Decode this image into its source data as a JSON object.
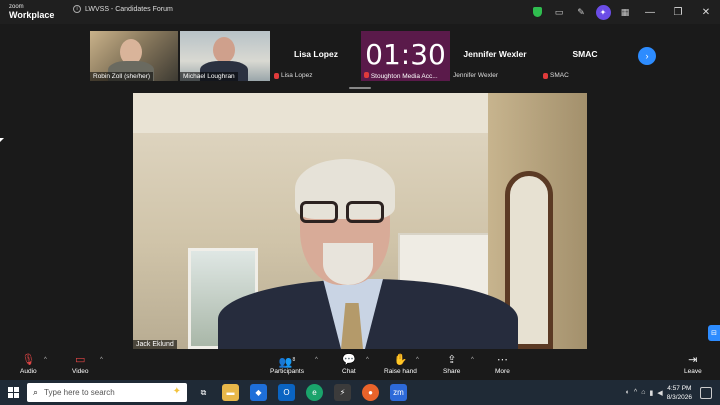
{
  "titlebar": {
    "brand_line1": "zoom",
    "brand_line2": "Workplace",
    "meeting_title": "LWVSS - Candidates  Forum",
    "icons": [
      "shield-icon",
      "tablet-icon",
      "pen-icon",
      "ai-companion-icon",
      "apps-icon"
    ],
    "window_buttons": [
      "minimize",
      "restore",
      "close"
    ]
  },
  "gallery": {
    "tiles": [
      {
        "name": "Robin Zoll (she/her)"
      },
      {
        "name": "Michael Loughran"
      },
      {
        "name": "Lisa Lopez",
        "label": "Lisa Lopez"
      },
      {
        "timer": "01:30",
        "label": "Stoughton Media Acc..."
      },
      {
        "name": "Jennifer Wexler",
        "label": "Jennifer Wexler"
      },
      {
        "name": "SMAC",
        "label": "SMAC"
      }
    ],
    "timer_color": "#5a1a4a"
  },
  "main_video": {
    "speaker_name": "Jack Eklund"
  },
  "toolbar": {
    "audio": "Audio",
    "video": "Video",
    "participants": "Participants",
    "participant_count": "8",
    "chat": "Chat",
    "raise_hand": "Raise hand",
    "share": "Share",
    "more": "More",
    "leave": "Leave"
  },
  "taskbar": {
    "search_placeholder": "Type here to search",
    "time": "4:57 PM",
    "date": "8/3/2026"
  },
  "colors": {
    "accent": "#2d8cff",
    "leave": "#e54646",
    "shield": "#2fbd4f"
  }
}
